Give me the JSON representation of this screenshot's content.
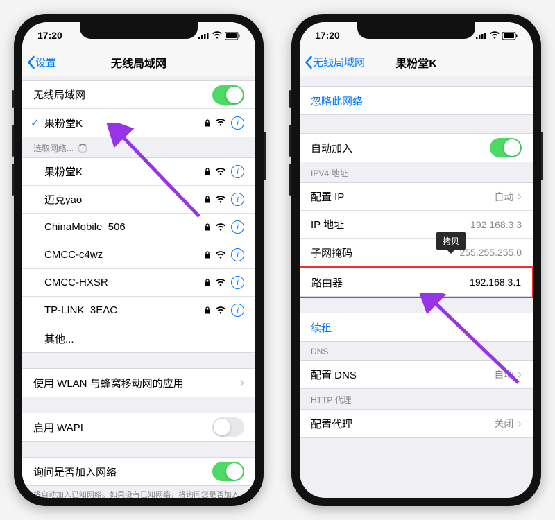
{
  "left": {
    "status_time": "17:20",
    "back": "设置",
    "title": "无线局域网",
    "wifi_label": "无线局域网",
    "connected": "果粉堂K",
    "choose": "选取网络...",
    "nets": [
      "果粉堂K",
      "迈克yao",
      "ChinaMobile_506",
      "CMCC-c4wz",
      "CMCC-HXSR",
      "TP-LINK_3EAC"
    ],
    "other": "其他...",
    "apps": "使用 WLAN 与蜂窝移动网的应用",
    "wapi": "启用 WAPI",
    "ask": "询问是否加入网络",
    "ask_foot": "将自动加入已知网络。如果没有已知网络，将询问您是否加入新网络。"
  },
  "right": {
    "status_time": "17:20",
    "back": "无线局域网",
    "title": "果粉堂K",
    "forget": "忽略此网络",
    "auto": "自动加入",
    "ipv4_h": "IPV4 地址",
    "cfg_ip": "配置 IP",
    "cfg_ip_v": "自动",
    "ip": "IP 地址",
    "ip_v": "192.168.3.3",
    "mask": "子网掩码",
    "mask_v": "255.255.255.0",
    "router": "路由器",
    "router_v": "192.168.3.1",
    "copy": "拷贝",
    "renew": "续租",
    "dns_h": "DNS",
    "cfg_dns": "配置 DNS",
    "cfg_dns_v": "自动",
    "http_h": "HTTP 代理",
    "cfg_proxy": "配置代理",
    "cfg_proxy_v": "关闭"
  }
}
